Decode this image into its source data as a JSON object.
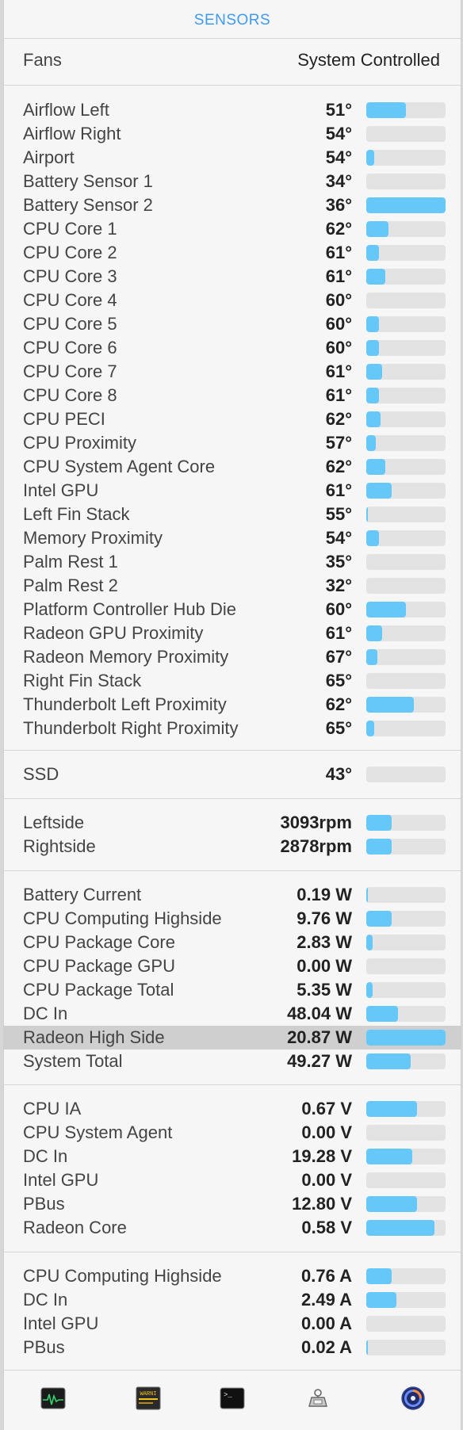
{
  "panel": {
    "title": "SENSORS"
  },
  "fans": {
    "label": "Fans",
    "value": "System Controlled"
  },
  "groups": [
    {
      "name": "temperature",
      "rows": [
        {
          "label": "Airflow Left",
          "value": "51°",
          "level": 0.5
        },
        {
          "label": "Airflow Right",
          "value": "54°",
          "level": 0
        },
        {
          "label": "Airport",
          "value": "54°",
          "level": 0.1
        },
        {
          "label": "Battery Sensor 1",
          "value": "34°",
          "level": 0
        },
        {
          "label": "Battery Sensor 2",
          "value": "36°",
          "level": 1.0
        },
        {
          "label": "CPU Core 1",
          "value": "62°",
          "level": 0.28
        },
        {
          "label": "CPU Core 2",
          "value": "61°",
          "level": 0.16
        },
        {
          "label": "CPU Core 3",
          "value": "61°",
          "level": 0.24
        },
        {
          "label": "CPU Core 4",
          "value": "60°",
          "level": 0
        },
        {
          "label": "CPU Core 5",
          "value": "60°",
          "level": 0.16
        },
        {
          "label": "CPU Core 6",
          "value": "60°",
          "level": 0.16
        },
        {
          "label": "CPU Core 7",
          "value": "61°",
          "level": 0.2
        },
        {
          "label": "CPU Core 8",
          "value": "61°",
          "level": 0.16
        },
        {
          "label": "CPU PECI",
          "value": "62°",
          "level": 0.18
        },
        {
          "label": "CPU Proximity",
          "value": "57°",
          "level": 0.12
        },
        {
          "label": "CPU System Agent Core",
          "value": "62°",
          "level": 0.24
        },
        {
          "label": "Intel GPU",
          "value": "61°",
          "level": 0.32
        },
        {
          "label": "Left Fin Stack",
          "value": "55°",
          "level": 0.02
        },
        {
          "label": "Memory Proximity",
          "value": "54°",
          "level": 0.16
        },
        {
          "label": "Palm Rest 1",
          "value": "35°",
          "level": 0
        },
        {
          "label": "Palm Rest 2",
          "value": "32°",
          "level": 0
        },
        {
          "label": "Platform Controller Hub Die",
          "value": "60°",
          "level": 0.5
        },
        {
          "label": "Radeon GPU Proximity",
          "value": "61°",
          "level": 0.2
        },
        {
          "label": "Radeon Memory Proximity",
          "value": "67°",
          "level": 0.14
        },
        {
          "label": "Right Fin Stack",
          "value": "65°",
          "level": 0
        },
        {
          "label": "Thunderbolt Left Proximity",
          "value": "62°",
          "level": 0.6
        },
        {
          "label": "Thunderbolt Right Proximity",
          "value": "65°",
          "level": 0.1
        }
      ]
    },
    {
      "name": "disk",
      "rows": [
        {
          "label": "SSD",
          "value": "43°",
          "level": 0
        }
      ]
    },
    {
      "name": "fan-speed",
      "rows": [
        {
          "label": "Leftside",
          "value": "3093rpm",
          "level": 0.32
        },
        {
          "label": "Rightside",
          "value": "2878rpm",
          "level": 0.32
        }
      ]
    },
    {
      "name": "power",
      "rows": [
        {
          "label": "Battery Current",
          "value": "0.19 W",
          "level": 0.02
        },
        {
          "label": "CPU Computing Highside",
          "value": "9.76 W",
          "level": 0.32
        },
        {
          "label": "CPU Package Core",
          "value": "2.83 W",
          "level": 0.08
        },
        {
          "label": "CPU Package GPU",
          "value": "0.00 W",
          "level": 0
        },
        {
          "label": "CPU Package Total",
          "value": "5.35 W",
          "level": 0.08
        },
        {
          "label": "DC In",
          "value": "48.04 W",
          "level": 0.4
        },
        {
          "label": "Radeon High Side",
          "value": "20.87 W",
          "level": 1.0,
          "highlighted": true
        },
        {
          "label": "System Total",
          "value": "49.27 W",
          "level": 0.56
        }
      ]
    },
    {
      "name": "voltage",
      "rows": [
        {
          "label": "CPU IA",
          "value": "0.67 V",
          "level": 0.64
        },
        {
          "label": "CPU System Agent",
          "value": "0.00 V",
          "level": 0
        },
        {
          "label": "DC In",
          "value": "19.28 V",
          "level": 0.58
        },
        {
          "label": "Intel GPU",
          "value": "0.00 V",
          "level": 0
        },
        {
          "label": "PBus",
          "value": "12.80 V",
          "level": 0.64
        },
        {
          "label": "Radeon Core",
          "value": "0.58 V",
          "level": 0.86
        }
      ]
    },
    {
      "name": "current",
      "rows": [
        {
          "label": "CPU Computing Highside",
          "value": "0.76 A",
          "level": 0.32
        },
        {
          "label": "DC In",
          "value": "2.49 A",
          "level": 0.38
        },
        {
          "label": "Intel GPU",
          "value": "0.00 A",
          "level": 0
        },
        {
          "label": "PBus",
          "value": "0.02 A",
          "level": 0.02
        }
      ]
    }
  ],
  "toolbar": {
    "items": [
      {
        "icon": "activity-monitor-icon"
      },
      {
        "icon": "console-icon",
        "text": "WARNI"
      },
      {
        "icon": "terminal-icon",
        "text": ">_"
      },
      {
        "icon": "system-information-icon"
      },
      {
        "icon": "istat-menus-icon"
      }
    ]
  },
  "colors": {
    "accent": "#3d9bf2",
    "bar_fill": "#66c8f8",
    "bar_track": "#e3e3e3",
    "highlight": "#cfcfcf"
  }
}
